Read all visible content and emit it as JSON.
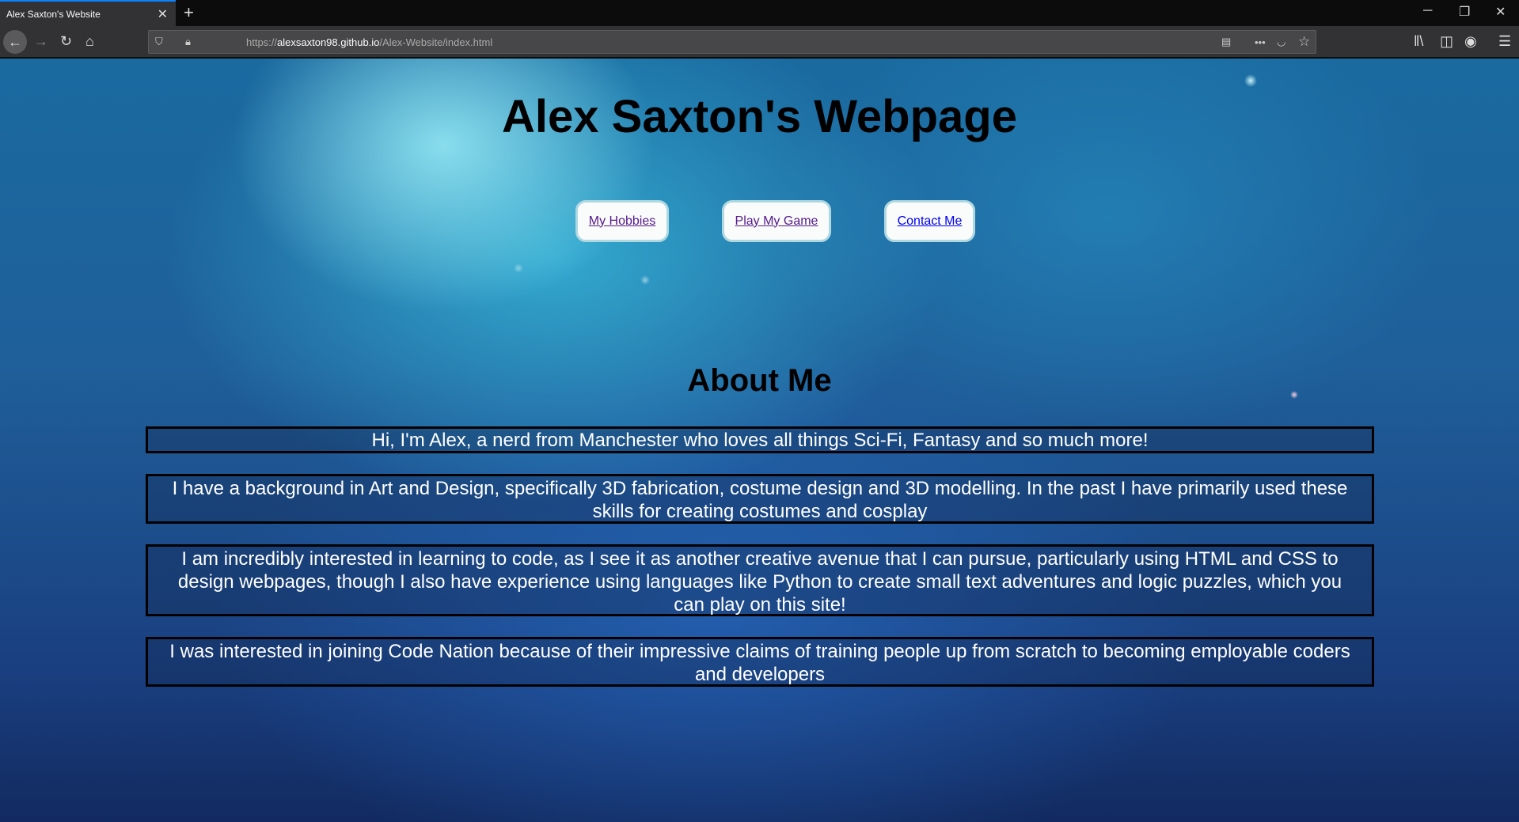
{
  "browser": {
    "tab_title": "Alex Saxton's Website",
    "url_scheme": "https://",
    "url_host": "alexsaxton98.github.io",
    "url_path": "/Alex-Website/index.html"
  },
  "page": {
    "title": "Alex Saxton's Webpage",
    "nav": [
      {
        "label": "My Hobbies"
      },
      {
        "label": "Play My Game"
      },
      {
        "label": "Contact Me"
      }
    ],
    "about_heading": "About Me",
    "paragraphs": [
      "Hi, I'm Alex, a nerd from Manchester who loves all things Sci-Fi, Fantasy and so much more!",
      "I have a background in Art and Design, specifically 3D fabrication, costume design and 3D modelling. In the past I have primarily used these skills for creating costumes and cosplay",
      "I am incredibly interested in learning to code, as I see it as another creative avenue that I can pursue, particularly using HTML and CSS to design webpages, though I also have experience using languages like Python to create small text adventures and logic puzzles, which you can play on this site!",
      "I was interested in joining Code Nation because of their impressive claims of training people up from scratch to becoming employable coders and developers"
    ]
  }
}
